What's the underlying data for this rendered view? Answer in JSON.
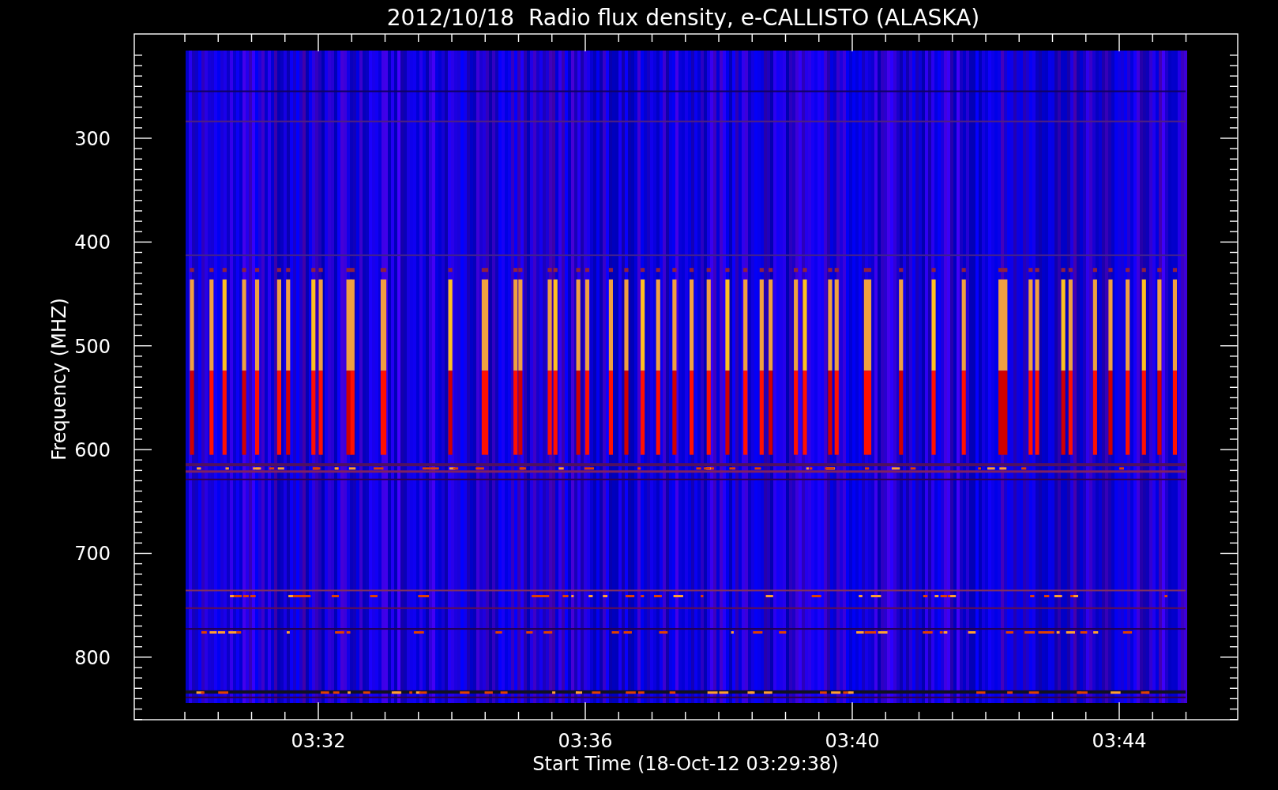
{
  "plot": {
    "title": "2012/10/18  Radio flux density, e-CALLISTO (ALASKA)",
    "xlabel": "Start Time (18-Oct-12 03:29:38)",
    "ylabel": "Frequency (MHZ)",
    "xticks": [
      "03:32",
      "03:36",
      "03:40",
      "03:44"
    ],
    "yticks": [
      "300",
      "400",
      "500",
      "600",
      "700",
      "800"
    ]
  }
}
